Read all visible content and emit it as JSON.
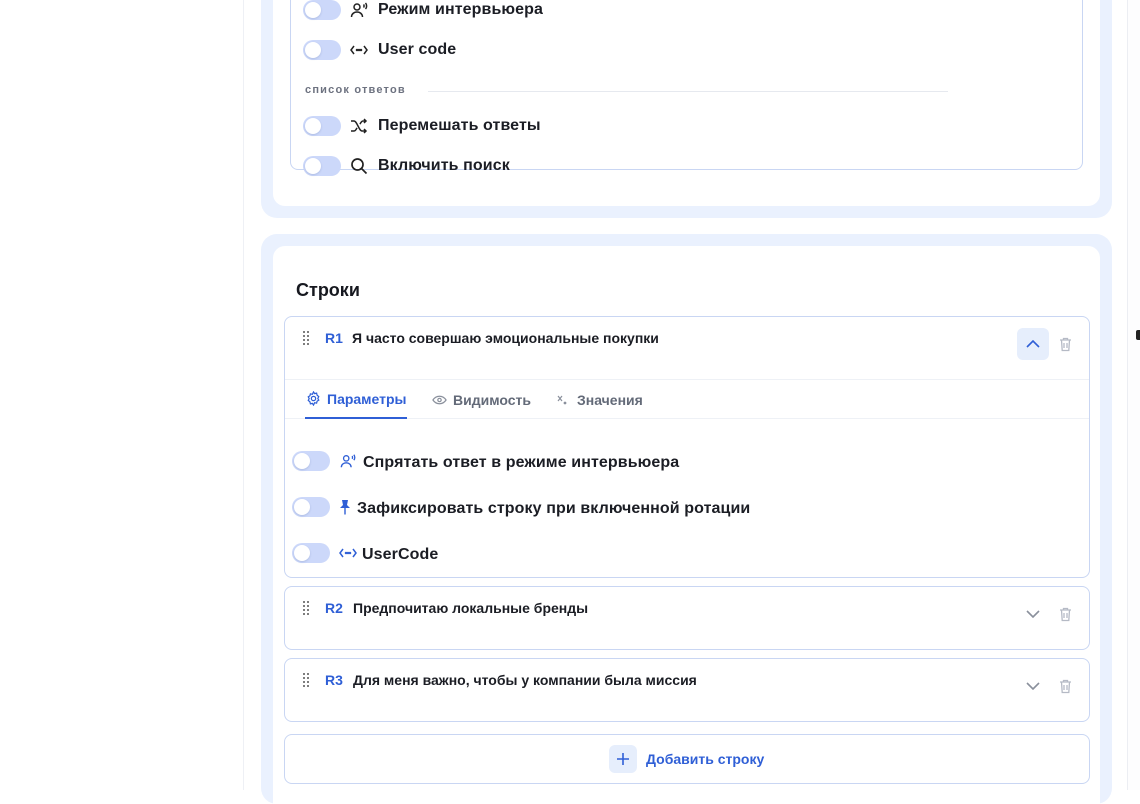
{
  "options_card": {
    "items_top": [
      {
        "label": "Режим интервьюера",
        "icon": "interviewer-icon",
        "enabled": false
      },
      {
        "label": "User code",
        "icon": "code-icon",
        "enabled": false
      }
    ],
    "section_label": "список ответов",
    "items_answers": [
      {
        "label": "Перемешать ответы",
        "icon": "shuffle-icon",
        "enabled": false
      },
      {
        "label": "Включить поиск",
        "icon": "search-icon",
        "enabled": false
      }
    ]
  },
  "rows_card": {
    "title": "Строки",
    "rows": [
      {
        "code": "R1",
        "text": "Я часто совершаю эмоциональные покупки",
        "expanded": true
      },
      {
        "code": "R2",
        "text": "Предпочитаю локальные бренды",
        "expanded": false
      },
      {
        "code": "R3",
        "text": "Для меня важно, чтобы у компании была миссия",
        "expanded": false
      }
    ],
    "tabs": [
      {
        "label": "Параметры",
        "icon": "gear-icon",
        "active": true
      },
      {
        "label": "Видимость",
        "icon": "eye-icon",
        "active": false
      },
      {
        "label": "Значения",
        "icon": "variable-icon",
        "active": false
      }
    ],
    "row_settings": [
      {
        "label": "Спрятать ответ в режиме интервьюера",
        "icon": "interviewer-icon",
        "enabled": false
      },
      {
        "label": "Зафиксировать строку при включенной ротации",
        "icon": "pin-icon",
        "enabled": false
      },
      {
        "label": "UserCode",
        "icon": "code-icon",
        "enabled": false
      }
    ],
    "add_label": "Добавить строку"
  },
  "colors": {
    "accent": "#2f5fd6",
    "card_bg": "#eaf1fe",
    "toggle_off": "#ccd8fa",
    "border": "#c9d6f3"
  }
}
